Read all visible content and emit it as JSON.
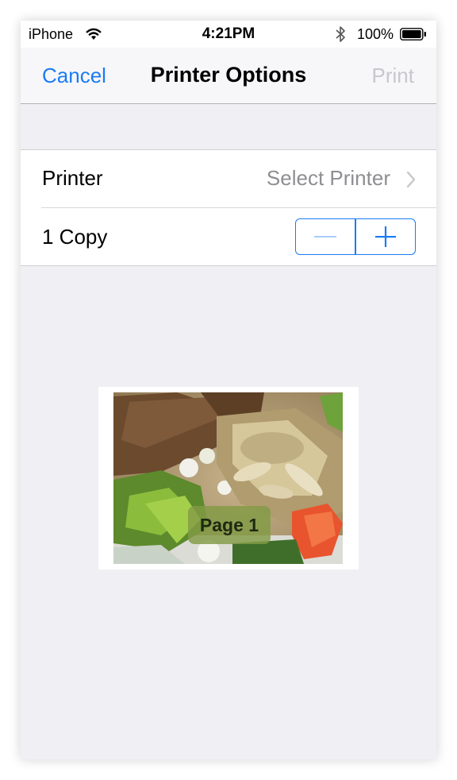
{
  "status_bar": {
    "carrier": "iPhone",
    "time": "4:21PM",
    "battery": "100%"
  },
  "nav": {
    "cancel_label": "Cancel",
    "title": "Printer Options",
    "print_label": "Print"
  },
  "settings": {
    "printer_label": "Printer",
    "printer_value": "Select Printer",
    "copies_label": "1 Copy"
  },
  "preview": {
    "page_label": "Page 1"
  },
  "colors": {
    "accent": "#1a7cf2",
    "disabled": "#c8c8cc",
    "secondary_text": "#8e8e93",
    "background": "#efeff4"
  },
  "icons": [
    "wifi-icon",
    "bluetooth-icon",
    "battery-icon",
    "chevron-right-icon",
    "minus-icon",
    "plus-icon"
  ]
}
